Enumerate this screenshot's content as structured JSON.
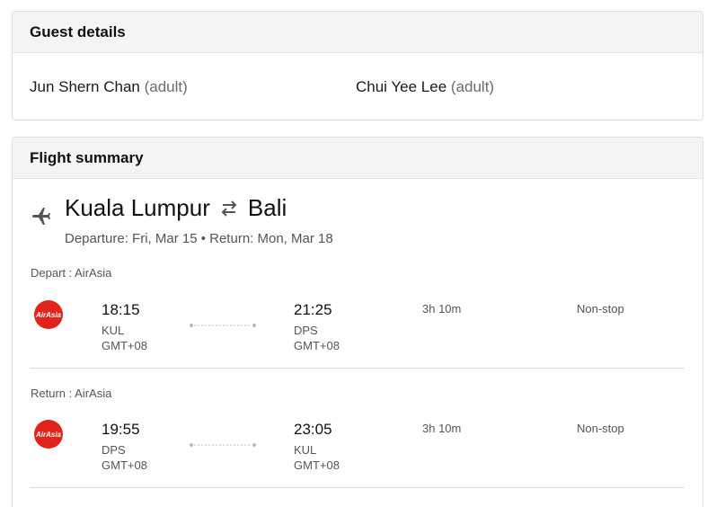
{
  "guest_details": {
    "title": "Guest details",
    "guests": [
      {
        "name": "Jun Shern Chan",
        "role": "(adult)"
      },
      {
        "name": "Chui Yee Lee",
        "role": "(adult)"
      }
    ]
  },
  "flight_summary": {
    "title": "Flight summary",
    "origin": "Kuala Lumpur",
    "destination": "Bali",
    "dates": "Departure: Fri, Mar 15 • Return: Mon, Mar 18",
    "legs": [
      {
        "label": "Depart : AirAsia",
        "airline_logo_text": "AirAsia",
        "dep_time": "18:15",
        "dep_code": "KUL",
        "dep_tz": "GMT+08",
        "arr_time": "21:25",
        "arr_code": "DPS",
        "arr_tz": "GMT+08",
        "duration": "3h 10m",
        "stops": "Non-stop"
      },
      {
        "label": "Return : AirAsia",
        "airline_logo_text": "AirAsia",
        "dep_time": "19:55",
        "dep_code": "DPS",
        "dep_tz": "GMT+08",
        "arr_time": "23:05",
        "arr_code": "KUL",
        "arr_tz": "GMT+08",
        "duration": "3h 10m",
        "stops": "Non-stop"
      }
    ]
  },
  "colors": {
    "airasia_red": "#e2231a",
    "header_bg": "#f4f4f4",
    "border": "#dedede"
  }
}
